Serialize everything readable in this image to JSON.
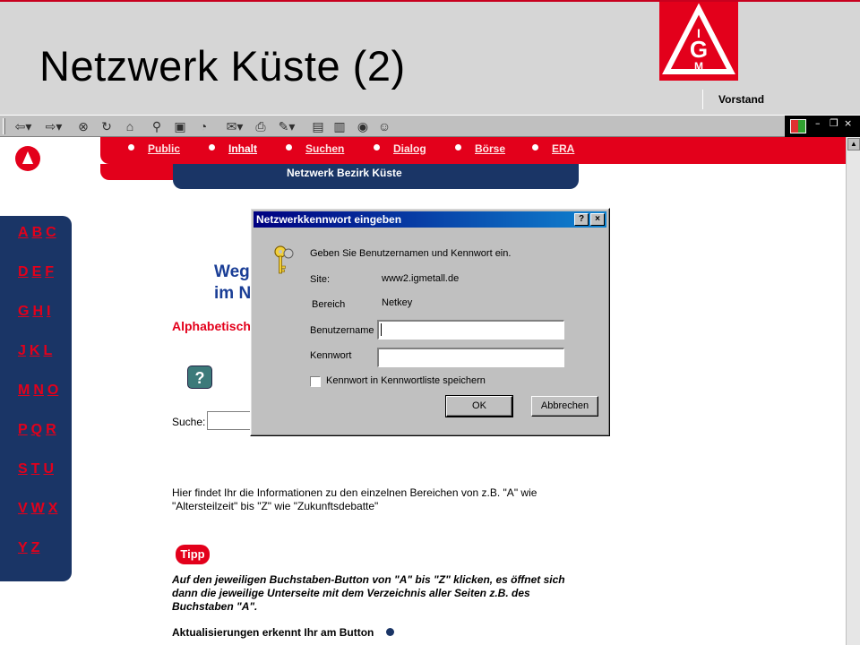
{
  "slide": {
    "title": "Netzwerk Küste (2)",
    "org_label": "Vorstand",
    "logo_letters": "IGM"
  },
  "toolbar": {
    "icons": [
      "back-icon",
      "forward-icon",
      "stop-icon",
      "refresh-icon",
      "home-icon",
      "search-icon",
      "favorites-icon",
      "history-icon",
      "mail-icon",
      "print-icon",
      "edit-icon",
      "discuss-icon",
      "messenger-icon",
      "contacts-icon"
    ]
  },
  "nav": {
    "items": [
      "Public",
      "Inhalt",
      "Suchen",
      "Dialog",
      "Börse",
      "ERA"
    ],
    "subtitle": "Netzwerk Bezirk Küste"
  },
  "alphabet": {
    "rows": [
      [
        "A",
        "B",
        "C"
      ],
      [
        "D",
        "E",
        "F"
      ],
      [
        "G",
        "H",
        "I"
      ],
      [
        "J",
        "K",
        "L"
      ],
      [
        "M",
        "N",
        "O"
      ],
      [
        "P",
        "Q",
        "R"
      ],
      [
        "S",
        "T",
        "U"
      ],
      [
        "V",
        "W",
        "X"
      ],
      [
        "Y",
        "Z"
      ]
    ]
  },
  "content": {
    "title_line1": "Weg",
    "title_line2": "im N",
    "alpha_heading": "Alphabetisch",
    "search_label": "Suche:",
    "info_text": "Hier findet Ihr die Informationen zu den einzelnen Bereichen von z.B. \"A\" wie \"Altersteilzeit\" bis \"Z\" wie \"Zukunftsdebatte\"",
    "tipp_label": "Tipp",
    "tipp_text": "Auf den jeweiligen Buchstaben-Button von \"A\" bis \"Z\" klicken, es öffnet sich dann die jeweilige Unterseite mit dem Verzeichnis aller Seiten z.B. des Buchstaben \"A\".",
    "update_text": "Aktualisierungen erkennt Ihr am Button"
  },
  "dialog": {
    "title": "Netzwerkkennwort eingeben",
    "help_label": "?",
    "close_label": "×",
    "prompt": "Geben Sie Benutzernamen und Kennwort ein.",
    "site_label": "Site:",
    "site_value": "www2.igmetall.de",
    "realm_label": "Bereich",
    "realm_value": "Netkey",
    "username_label": "Benutzername",
    "username_value": "",
    "password_label": "Kennwort",
    "password_value": "",
    "save_checkbox_label": "Kennwort in Kennwortliste speichern",
    "save_checked": false,
    "ok_label": "OK",
    "cancel_label": "Abbrechen"
  },
  "colors": {
    "brand_red": "#e3001b",
    "navy": "#1a3566",
    "dialog_gray": "#c0c0c0"
  }
}
